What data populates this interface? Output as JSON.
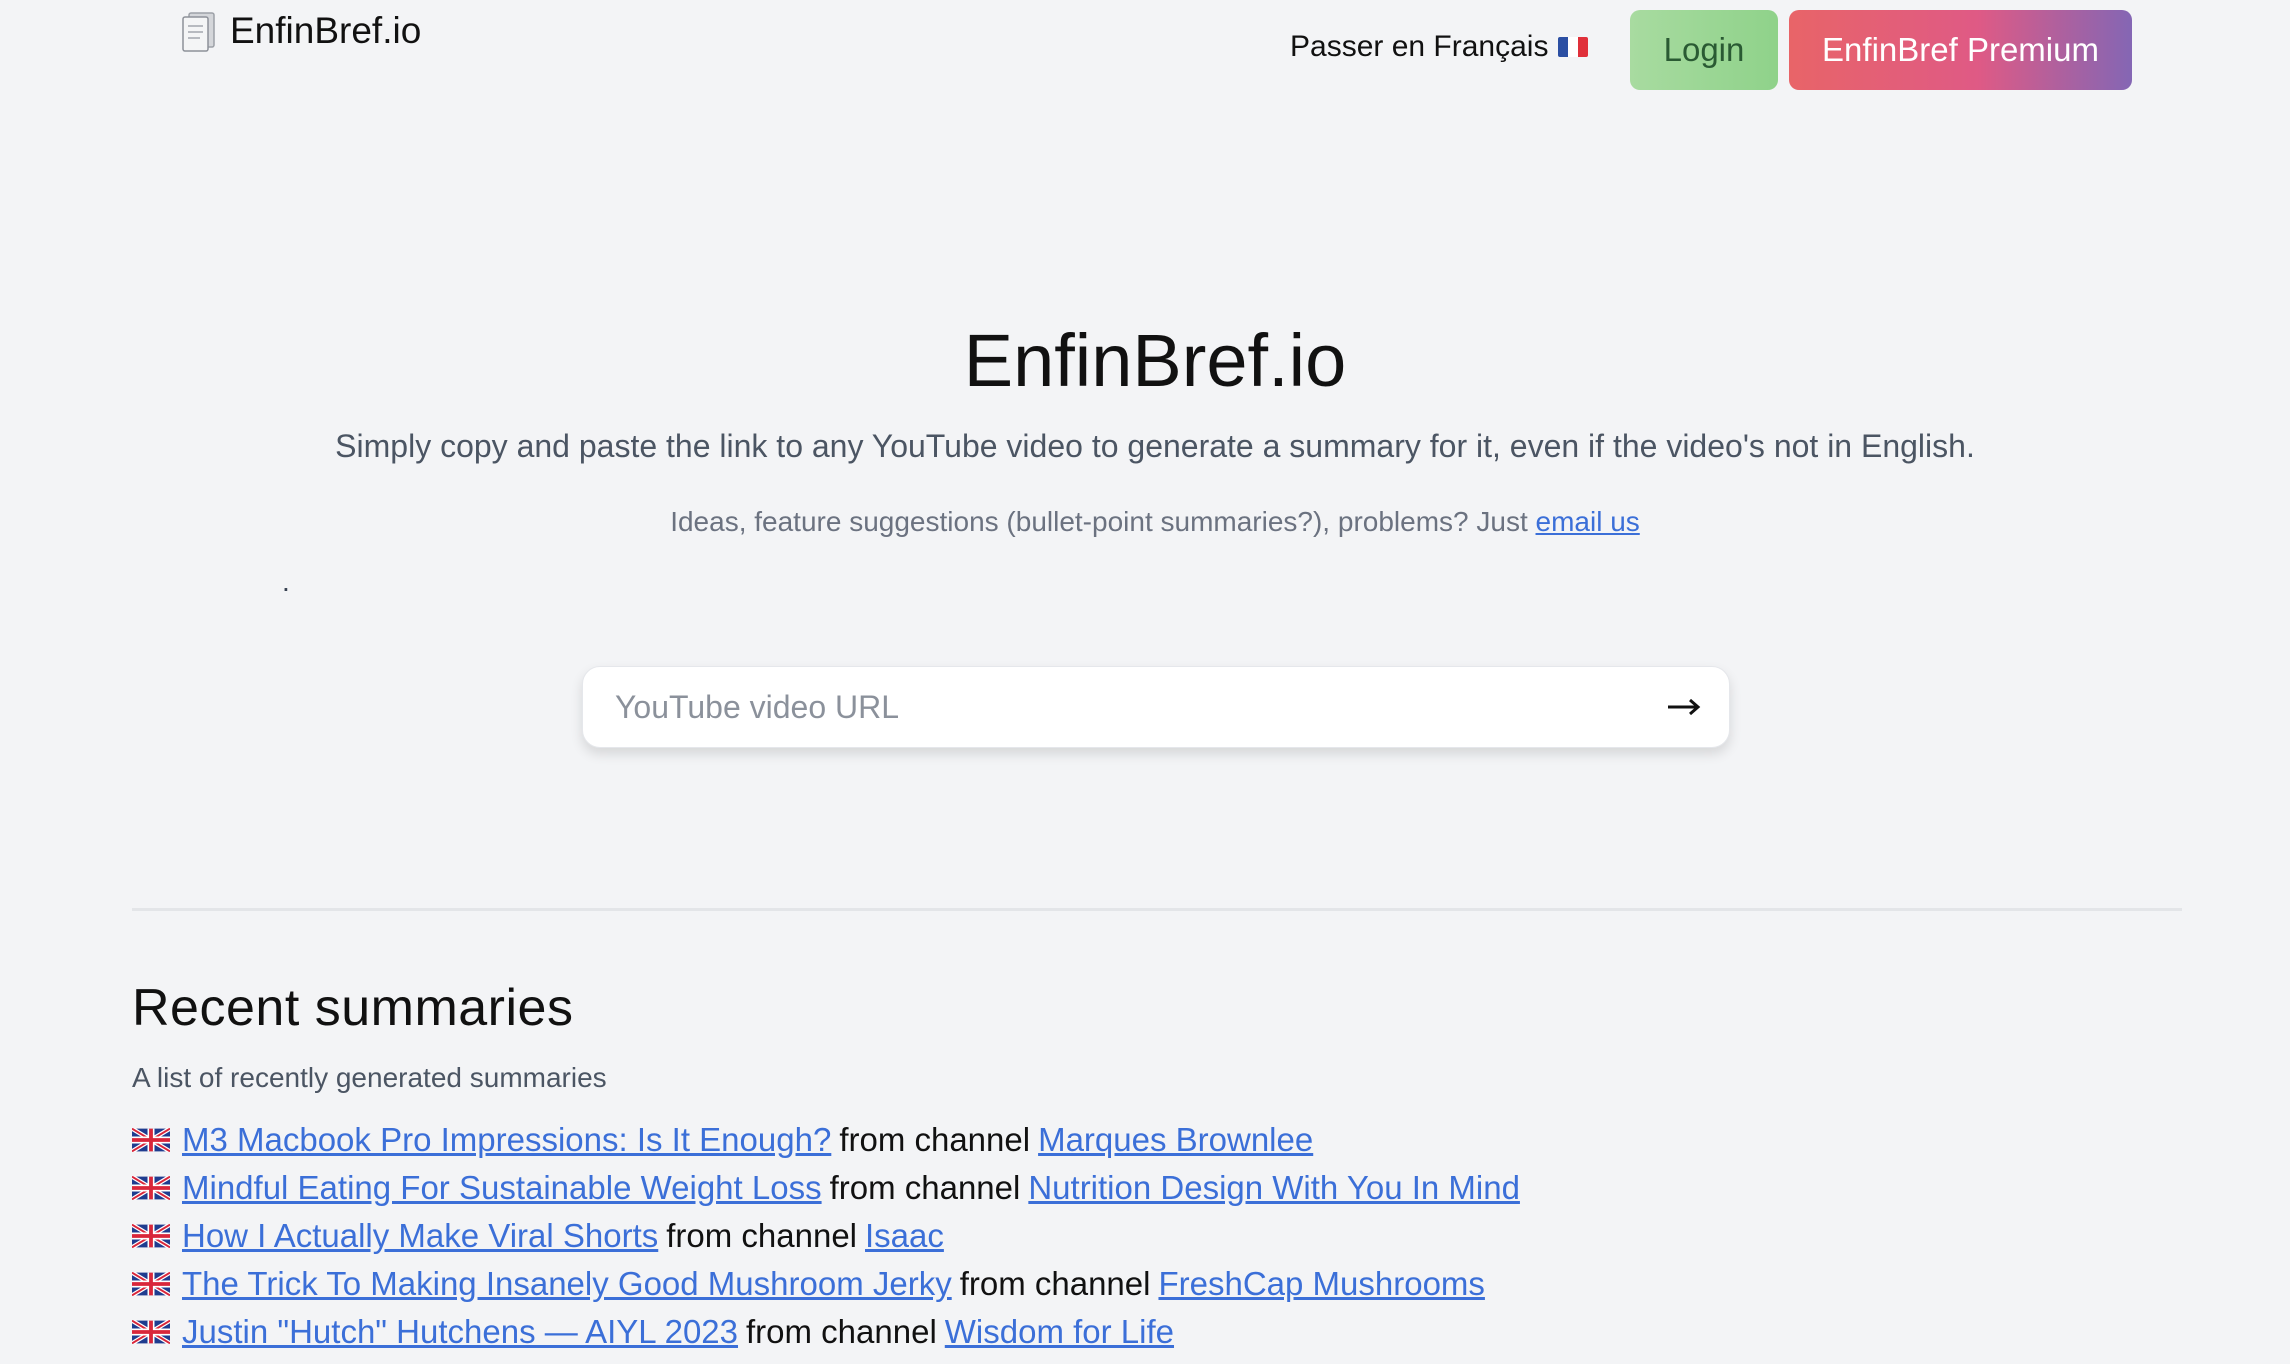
{
  "header": {
    "brand_name": "EnfinBref.io",
    "brand_icon": "page-icon",
    "lang_switch_label": "Passer en Français",
    "lang_flag": "fr-flag",
    "login_label": "Login",
    "premium_label": "EnfinBref Premium"
  },
  "hero": {
    "title": "EnfinBref.io",
    "subtitle": "Simply copy and paste the link to any YouTube video to generate a summary for it, even if the video's not in English.",
    "note_prefix": "Ideas, feature suggestions (bullet-point summaries?), problems? Just ",
    "note_link": "email us",
    "dot": "."
  },
  "search": {
    "placeholder": "YouTube video URL",
    "value": "",
    "submit_icon": "arrow-right-icon"
  },
  "recent": {
    "title": "Recent summaries",
    "description": "A list of recently generated summaries",
    "connector": "from channel",
    "items": [
      {
        "flag": "uk-flag",
        "video": "M3 Macbook Pro Impressions: Is It Enough?",
        "channel": "Marques Brownlee"
      },
      {
        "flag": "uk-flag",
        "video": "Mindful Eating For Sustainable Weight Loss",
        "channel": "Nutrition Design With You In Mind"
      },
      {
        "flag": "uk-flag",
        "video": "How I Actually Make Viral Shorts",
        "channel": "Isaac"
      },
      {
        "flag": "uk-flag",
        "video": "The Trick To Making Insanely Good Mushroom Jerky",
        "channel": "FreshCap Mushrooms"
      },
      {
        "flag": "uk-flag",
        "video": "Justin \"Hutch\" Hutchens — AIYL 2023",
        "channel": "Wisdom for Life"
      }
    ]
  },
  "colors": {
    "background": "#f3f4f6",
    "link": "#3b6fd8",
    "login_green": "#a8dba0",
    "premium_start": "#e86468",
    "premium_end": "#8466b4"
  }
}
